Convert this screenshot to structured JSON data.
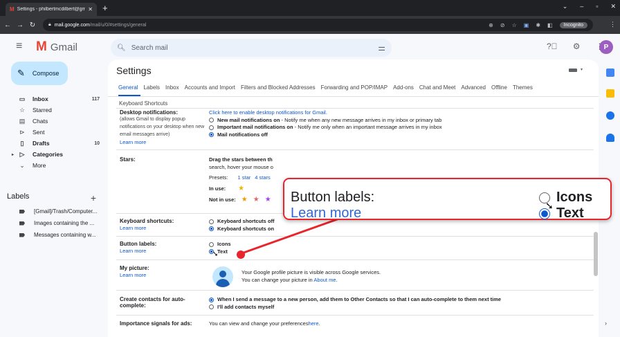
{
  "browser": {
    "tab_title": "Settings - philbertmcdilbert@gmail",
    "url_host": "mail.google.com",
    "url_path": "/mail/u/0/#settings/general",
    "incognito_label": "Incognito"
  },
  "gmail": {
    "logo_text": "Gmail",
    "search_placeholder": "Search mail",
    "avatar_letter": "P"
  },
  "compose_label": "Compose",
  "nav": [
    {
      "label": "Inbox",
      "count": "117",
      "bold": true,
      "icon": "inbox-icon"
    },
    {
      "label": "Starred",
      "count": "",
      "bold": false,
      "icon": "star-icon"
    },
    {
      "label": "Chats",
      "count": "",
      "bold": false,
      "icon": "chat-icon"
    },
    {
      "label": "Sent",
      "count": "",
      "bold": false,
      "icon": "send-icon"
    },
    {
      "label": "Drafts",
      "count": "10",
      "bold": true,
      "icon": "draft-icon"
    },
    {
      "label": "Categories",
      "count": "",
      "bold": true,
      "icon": "label-icon"
    },
    {
      "label": "More",
      "count": "",
      "bold": false,
      "icon": "chevron-down-icon"
    }
  ],
  "labels_heading": "Labels",
  "labels": [
    "[Gmail]/Trash/Computer...",
    "Images containing the ...",
    "Messages containing w..."
  ],
  "settings": {
    "title": "Settings",
    "tabs": [
      "General",
      "Labels",
      "Inbox",
      "Accounts and Import",
      "Filters and Blocked Addresses",
      "Forwarding and POP/IMAP",
      "Add-ons",
      "Chat and Meet",
      "Advanced",
      "Offline",
      "Themes"
    ],
    "tabs_row2": "Keyboard Shortcuts",
    "desktop": {
      "label": "Desktop notifications:",
      "sub": [
        "(allows Gmail to display popup",
        "notifications on your desktop when new",
        "email messages arrive)"
      ],
      "learn": "Learn more",
      "enable_link": "Click here to enable desktop notifications for Gmail.",
      "opt1_bold": "New mail notifications on",
      "opt1_rest": " - Notify me when any new message arrives in my inbox or primary tab",
      "opt2_bold": "Important mail notifications on",
      "opt2_rest": " - Notify me only when an important message arrives in my inbox",
      "opt3_bold": "Mail notifications off"
    },
    "stars": {
      "label": "Stars:",
      "line1": "Drag the stars between th",
      "line2": "search, hover your mouse o",
      "presets_label": "Presets:",
      "preset1": "1 star",
      "preset2": "4 stars",
      "in_use": "In use:",
      "not_in_use": "Not in use:"
    },
    "keyboard": {
      "label": "Keyboard shortcuts:",
      "learn": "Learn more",
      "opt_off": "Keyboard shortcuts off",
      "opt_on": "Keyboard shortcuts on"
    },
    "button_labels": {
      "label": "Button labels:",
      "learn": "Learn more",
      "opt_icons": "Icons",
      "opt_text": "Text"
    },
    "picture": {
      "label": "My picture:",
      "learn": "Learn more",
      "line1": "Your Google profile picture is visible across Google services.",
      "line2_pre": "You can change your picture in ",
      "line2_link": "About me",
      "line2_post": "."
    },
    "contacts": {
      "label": "Create contacts for auto-",
      "label2": "complete:",
      "opt1": "When I send a message to a new person, add them to Other Contacts so that I can auto-complete to them next time",
      "opt2": "I'll add contacts myself"
    },
    "importance": {
      "label": "Importance signals for ads:",
      "text_pre": "You can view and change your preferences ",
      "text_link": "here",
      "text_post": "."
    }
  },
  "callout": {
    "label": "Button labels:",
    "learn": "Learn more",
    "opt_icons": "Icons",
    "opt_text": "Text",
    "border_color": "#e8252b"
  },
  "colors": {
    "accent": "#0b57d0",
    "highlight": "#e8252b"
  }
}
